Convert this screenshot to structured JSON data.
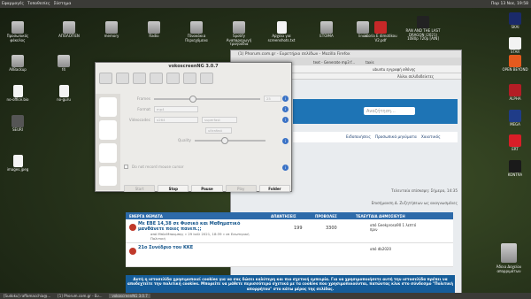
{
  "topbar": {
    "menu": [
      "Εφαρμογές",
      "Τοποθεσίες",
      "Σύστημα"
    ],
    "tray": "Παρ 13 Νοε, 19:58"
  },
  "desktop_left": [
    {
      "label": "Προσωπικός φάκελος"
    },
    {
      "label": "ΑΠΟΛΟΓΙΕΝ"
    },
    {
      "label": "memory"
    },
    {
      "label": "Radio"
    },
    {
      "label": "Πίνακάκια Περιεχόμενα"
    },
    {
      "label": "Spotify Αναπαραγωγή τραγούδια"
    },
    {
      "label": "Αρχεία για screenshots.txt"
    },
    {
      "label": "EΤΟΙΜΑ"
    },
    {
      "label": "linux"
    },
    {
      "label": "istoria E dimotikou V2.pdf"
    },
    {
      "label": "RAN AND THE LAST DRAGON (2021) 1080p 720p [AtN]"
    },
    {
      "label": "AllBackup"
    },
    {
      "label": "f4"
    },
    {
      "label": "no-office.bio"
    },
    {
      "label": "no-guru"
    },
    {
      "label": "SEURI"
    },
    {
      "label": "images.jpeg"
    }
  ],
  "desktop_right": [
    {
      "label": "SKAI"
    },
    {
      "label": "STAR"
    },
    {
      "label": "OPEN BEYOND"
    },
    {
      "label": "ALPHA"
    },
    {
      "label": "MEGA"
    },
    {
      "label": "ERT"
    },
    {
      "label": "KONTRA"
    }
  ],
  "trash": "Άδεια Δοχείου απορριμάτων",
  "firefox": {
    "title": "(1) Phorum.com.gr - Ευρετήριο σελίδων - Mozilla Firefox",
    "tabs": [
      "text - Generate mp3 f...",
      "taxis"
    ],
    "url": "ubuntu εγγραφή οθόνης",
    "bookmarks": "Άλλοι σελιδοδείκτες",
    "search_ph": "Αναζήτηση…",
    "notifications": "Ειδοποιήσεις",
    "pm": "Προσωπικά μηνύματα",
    "user": "Χαιατικός",
    "last_visit": "Τελευταία επίσκεψη: Σήμερα, 14:35",
    "last_member": "Επισήμανση Δ. Ζυζητήσεων ως αναγνωσμένες"
  },
  "forum": {
    "section": "ΕΝΕΡΓΑ ΘΕΜΑΤΑ",
    "cols": [
      "ΑΠΑΝΤΗΣΕΙΣ",
      "ΠΡΟΒΟΛΕΣ",
      "ΤΕΛΕΥΤΑΙΑ ΔΗΜΟΣΙΕΥΣΗ"
    ],
    "rows": [
      {
        "title": "Με ΕΒΕ 14,38 σε Φυσικό και Μαθηματικό μανθάνετε ποιες πανεπ.;;",
        "meta": "από ΜπλεΜπουμπης » 29 Ιούλ 2021, 18:39 » σε Εσωτερική Πολιτική",
        "replies": "199",
        "views": "3300",
        "last": "από Geekprosa90 1 λεπτό πριν"
      },
      {
        "title": "21ο Συνέδριο του ΚΚΕ",
        "meta": "",
        "replies": "",
        "views": "",
        "last": "από db2020"
      }
    ]
  },
  "vk": {
    "title": "vokoscreenNG 3.0.7",
    "frames_label": "Frames",
    "frames": "25",
    "format_label": "Format",
    "format": "mp4",
    "videocodec_label": "Videocodec",
    "videocodec": "x264",
    "codec2": "superfast",
    "preset": "ultrafast",
    "quality_label": "Quality",
    "quality": "17",
    "check": "Do not record mouse cursor",
    "btns": [
      "Start",
      "Stop",
      "Pause",
      "Play",
      "Folder"
    ]
  },
  "cookie": "Αυτή η ιστοσελίδα χρησιμοποιεί cookies για να σας δώσει καλύτερη και πιο σχετική εμπειρία. Για να χρησιμοποιήσετε αυτή την ιστοσελίδα πρέπει να αποδεχτείτε την πολιτική cookies. Μπορείτε να μάθετε περισσότερα σχετικά με τα cookies που χρησιμοποιούνται, πατώντας κλικ στο σύνδεσμο \"Πολιτική απορρήτου\" στο κάτω μέρος της σελίδας.",
  "taskbar": [
    "[Sudoku] raffamacchia@...",
    "[1] Phorum.com.gr - Ευ...",
    "vokoscreenNG 3.0.7"
  ]
}
